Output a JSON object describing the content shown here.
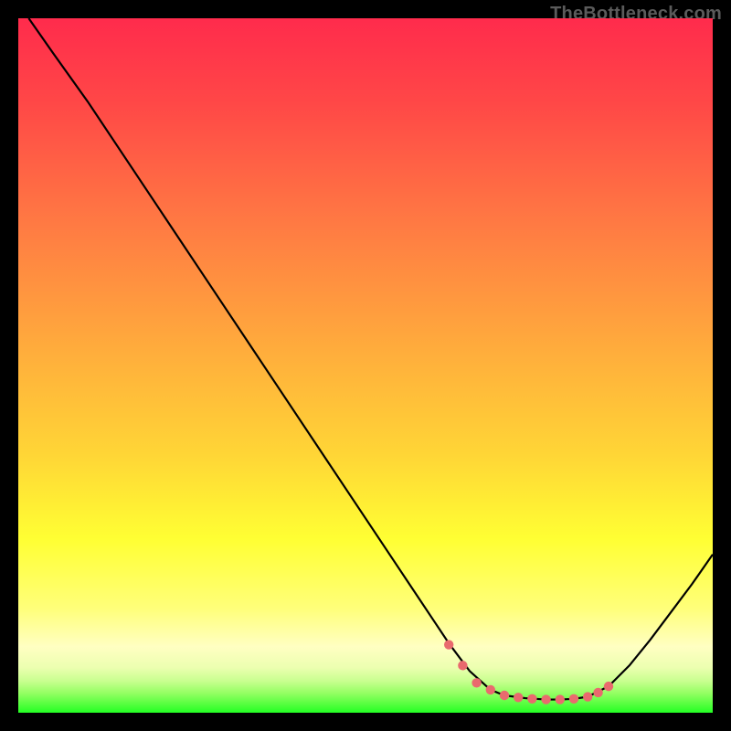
{
  "watermark": "TheBottleneck.com",
  "colors": {
    "background": "#000000",
    "watermark": "#5b5b5b",
    "curve": "#000000",
    "marker": "#e96a6e",
    "gradient_top": "#ff2b4c",
    "gradient_mid1": "#ff8b3f",
    "gradient_mid2": "#ffd138",
    "gradient_mid3": "#ffff34",
    "gradient_mid4": "#ffff9a",
    "gradient_mid5": "#d8ff9a",
    "gradient_bottom": "#2bff2b"
  },
  "chart_data": {
    "type": "line",
    "title": "",
    "xlabel": "",
    "ylabel": "",
    "xlim": [
      0,
      100
    ],
    "ylim": [
      0,
      100
    ],
    "series": [
      {
        "name": "curve",
        "x": [
          1.5,
          5,
          10,
          15,
          20,
          25,
          30,
          35,
          40,
          45,
          50,
          55,
          60,
          62,
          65,
          68,
          70,
          73,
          76,
          78,
          80,
          82,
          85,
          88,
          91,
          94,
          97,
          100
        ],
        "y": [
          100,
          95,
          88,
          80.5,
          73,
          65.5,
          58,
          50.5,
          43,
          35.5,
          28,
          20.5,
          13,
          10,
          6,
          3.3,
          2.5,
          2.1,
          1.9,
          1.9,
          2.0,
          2.3,
          3.8,
          6.8,
          10.5,
          14.5,
          18.5,
          22.8
        ]
      }
    ],
    "markers": {
      "name": "flat-region",
      "x": [
        62,
        64,
        66,
        68,
        70,
        72,
        74,
        76,
        78,
        80,
        82,
        83.5,
        85
      ],
      "y": [
        9.8,
        6.8,
        4.3,
        3.3,
        2.5,
        2.2,
        2.0,
        1.9,
        1.9,
        2.0,
        2.3,
        2.9,
        3.8
      ]
    },
    "gradient_stops": [
      {
        "offset": 0.0,
        "color": "#ff2b4c"
      },
      {
        "offset": 0.12,
        "color": "#ff4747"
      },
      {
        "offset": 0.3,
        "color": "#ff7b43"
      },
      {
        "offset": 0.48,
        "color": "#ffad3c"
      },
      {
        "offset": 0.63,
        "color": "#ffd636"
      },
      {
        "offset": 0.75,
        "color": "#ffff33"
      },
      {
        "offset": 0.85,
        "color": "#ffff7a"
      },
      {
        "offset": 0.905,
        "color": "#ffffc2"
      },
      {
        "offset": 0.935,
        "color": "#ecffb0"
      },
      {
        "offset": 0.955,
        "color": "#c7ff8e"
      },
      {
        "offset": 0.972,
        "color": "#93ff62"
      },
      {
        "offset": 0.986,
        "color": "#5cff42"
      },
      {
        "offset": 1.0,
        "color": "#24ff24"
      }
    ]
  }
}
